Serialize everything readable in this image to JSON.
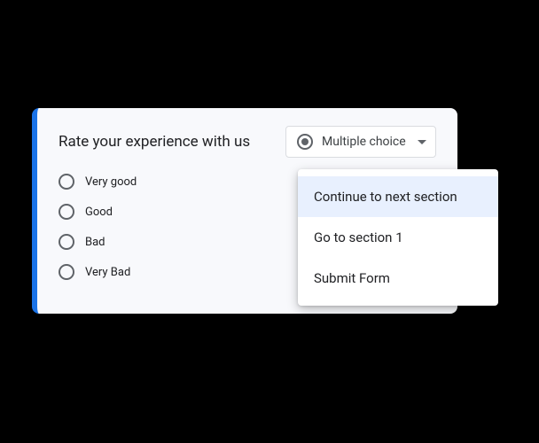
{
  "question": {
    "title": "Rate your experience with us",
    "type_label": "Multiple choice",
    "options": [
      {
        "label": "Very good"
      },
      {
        "label": "Good"
      },
      {
        "label": "Bad"
      },
      {
        "label": "Very Bad"
      }
    ]
  },
  "dropdown": {
    "items": [
      {
        "label": "Continue to next section",
        "selected": true
      },
      {
        "label": "Go to section 1",
        "selected": false
      },
      {
        "label": "Submit Form",
        "selected": false
      }
    ]
  }
}
